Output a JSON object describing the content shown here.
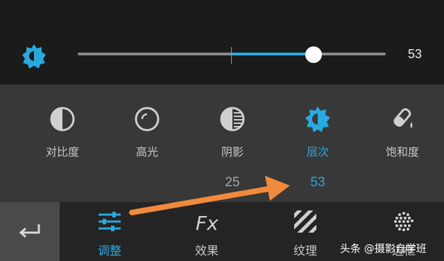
{
  "slider": {
    "icon": "brightness-half-icon",
    "value_text": "53",
    "value": 53,
    "min": -100,
    "max": 100,
    "accent_color": "#29a9e0"
  },
  "tools": [
    {
      "icon": "contrast-icon",
      "label": "对比度",
      "value": ""
    },
    {
      "icon": "highlight-icon",
      "label": "高光",
      "value": ""
    },
    {
      "icon": "shadow-icon",
      "label": "阴影",
      "value": "25"
    },
    {
      "icon": "levels-icon",
      "label": "层次",
      "value": "53",
      "active": true
    },
    {
      "icon": "saturation-icon",
      "label": "饱和度",
      "value": ""
    }
  ],
  "nav": {
    "back_icon": "return-icon",
    "tabs": [
      {
        "icon": "sliders-icon",
        "label": "调整",
        "active": true
      },
      {
        "icon": "fx-icon",
        "label": "效果"
      },
      {
        "icon": "texture-icon",
        "label": "纹理"
      },
      {
        "icon": "frame-dots-icon",
        "label": "边框"
      }
    ]
  },
  "watermark": "头条 @摄影自学班",
  "colors": {
    "accent": "#29a9e0",
    "annotation_arrow": "#f08a3c"
  }
}
